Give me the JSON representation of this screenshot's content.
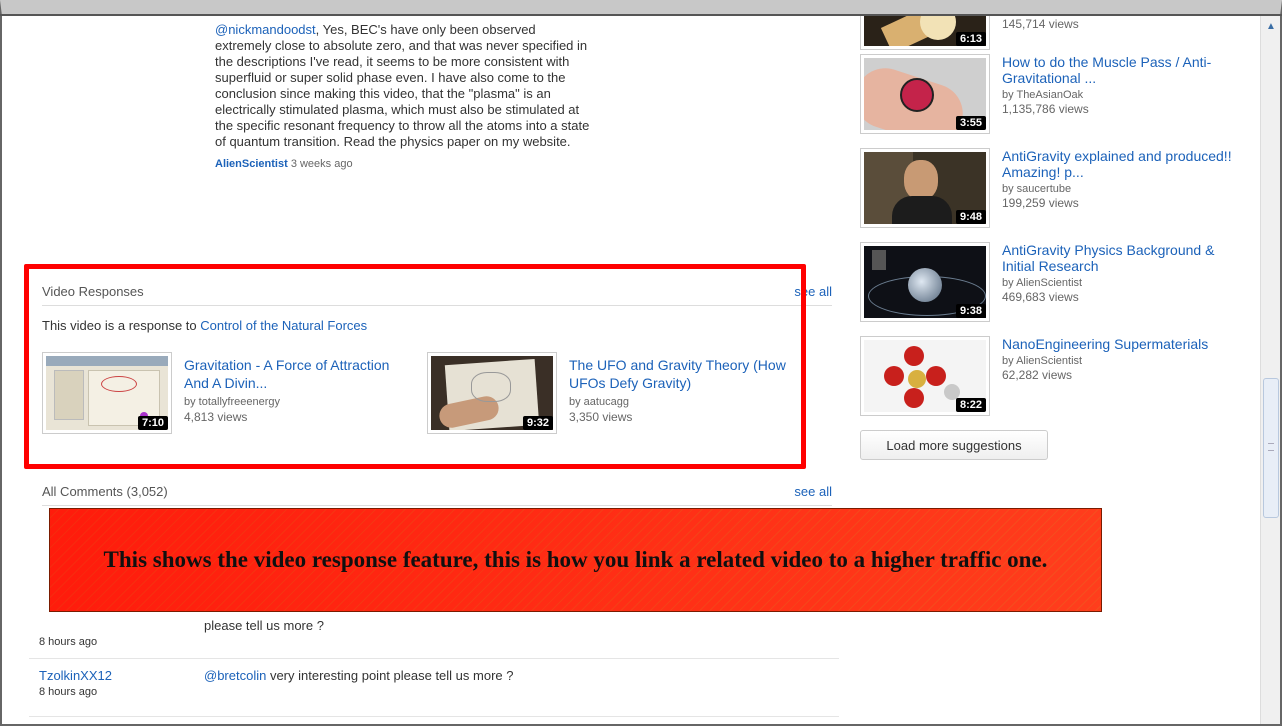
{
  "reply": {
    "mention": "@nickmandoodst",
    "text": ", Yes, BEC's have only been observed extremely close to absolute zero, and that was never specified in the descriptions I've read, it seems to be more consistent with superfluid or super solid phase even. I have also come to the conclusion since making this video, that the \"plasma\" is an electrically stimulated plasma, which must also be stimulated at the specific resonant frequency to throw all the atoms into a state of quantum transition. Read the physics paper on my website.",
    "author": "AlienScientist",
    "time": "3 weeks ago"
  },
  "video_responses": {
    "title": "Video Responses",
    "see_all": "see all",
    "response_prefix": "This video is a response to ",
    "response_link": "Control of the Natural Forces",
    "items": [
      {
        "title": "Gravitation - A Force of Attraction And A Divin...",
        "by": "by totallyfreeenergy",
        "views": "4,813 views",
        "duration": "7:10"
      },
      {
        "title": "The UFO and Gravity Theory (How UFOs Defy Gravity)",
        "by": "by aatucagg",
        "views": "3,350 views",
        "duration": "9:32"
      }
    ]
  },
  "all_comments": {
    "title": "All Comments (3,052)",
    "see_all": "see all"
  },
  "overlay": {
    "text": "This shows the video response feature, this is how you link a related video to a higher traffic one."
  },
  "comments": [
    {
      "author": "",
      "time": "8 hours ago",
      "mention": "",
      "text": "please tell us more ?"
    },
    {
      "author": "TzolkinXX12",
      "time": "8 hours ago",
      "mention": "@bretcolin",
      "text": " very interesting point please tell us more ?"
    }
  ],
  "sidebar": {
    "items": [
      {
        "title": "",
        "by": "",
        "views": "145,714 views",
        "duration": "6:13"
      },
      {
        "title": "How to do the Muscle Pass / Anti-Gravitational ...",
        "by": "by TheAsianOak",
        "views": "1,135,786 views",
        "duration": "3:55"
      },
      {
        "title": "AntiGravity explained and produced!! Amazing! p...",
        "by": "by saucertube",
        "views": "199,259 views",
        "duration": "9:48"
      },
      {
        "title": "AntiGravity Physics Background & Initial Research",
        "by": "by AlienScientist",
        "views": "469,683 views",
        "duration": "9:38"
      },
      {
        "title": "NanoEngineering Supermaterials",
        "by": "by AlienScientist",
        "views": "62,282 views",
        "duration": "8:22"
      }
    ],
    "load_more": "Load more suggestions"
  },
  "colors": {
    "link": "#1c62b9",
    "highlight_border": "#ff0000",
    "overlay": "#ff3b14"
  }
}
